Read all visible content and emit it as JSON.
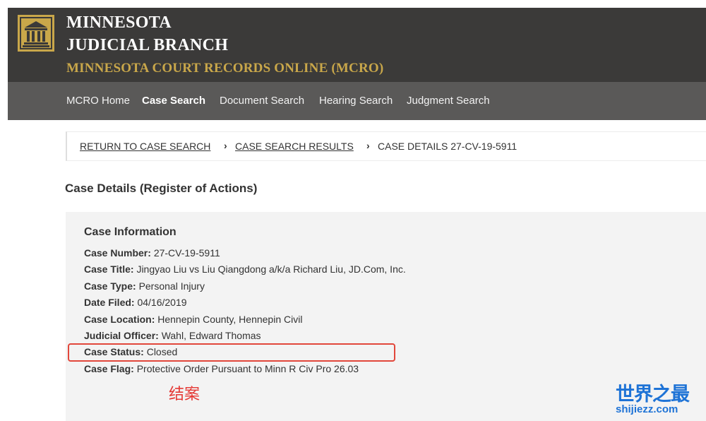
{
  "header": {
    "brand_line1": "MINNESOTA",
    "brand_line2": "JUDICIAL BRANCH",
    "subtitle": "MINNESOTA COURT RECORDS ONLINE (MCRO)",
    "logo_icon": "courthouse-icon",
    "colors": {
      "background": "#3b3a39",
      "gold": "#c9a74a"
    }
  },
  "nav": {
    "items": [
      {
        "label": "MCRO Home",
        "active": false
      },
      {
        "label": "Case Search",
        "active": true
      },
      {
        "label": "Document Search",
        "active": false
      },
      {
        "label": "Hearing Search",
        "active": false
      },
      {
        "label": "Judgment Search",
        "active": false
      }
    ],
    "background": "#5a5958"
  },
  "breadcrumb": {
    "items": [
      {
        "label": "RETURN TO CASE SEARCH",
        "link": true
      },
      {
        "label": "CASE SEARCH RESULTS",
        "link": true
      },
      {
        "label": "CASE DETAILS 27-CV-19-5911",
        "link": false
      }
    ],
    "separator_icon": "chevron-right-icon"
  },
  "page": {
    "title": "Case Details (Register of Actions)"
  },
  "case_info": {
    "heading": "Case Information",
    "fields": [
      {
        "label": "Case Number:",
        "value": "27-CV-19-5911"
      },
      {
        "label": "Case Title:",
        "value": "Jingyao Liu vs Liu Qiangdong a/k/a Richard Liu, JD.Com, Inc."
      },
      {
        "label": "Case Type:",
        "value": "Personal Injury"
      },
      {
        "label": "Date Filed:",
        "value": "04/16/2019"
      },
      {
        "label": "Case Location:",
        "value": "Hennepin County, Hennepin Civil"
      },
      {
        "label": "Judicial Officer:",
        "value": "Wahl, Edward Thomas"
      },
      {
        "label": "Case Status:",
        "value": "Closed"
      },
      {
        "label": "Case Flag:",
        "value": "Protective Order Pursuant to Minn R Civ Pro 26.03"
      }
    ],
    "annotation": "结案",
    "highlight_color": "#e2473b"
  },
  "watermark": {
    "title": "世界之最",
    "url": "shijiezz.com",
    "color": "#1e73d6"
  }
}
